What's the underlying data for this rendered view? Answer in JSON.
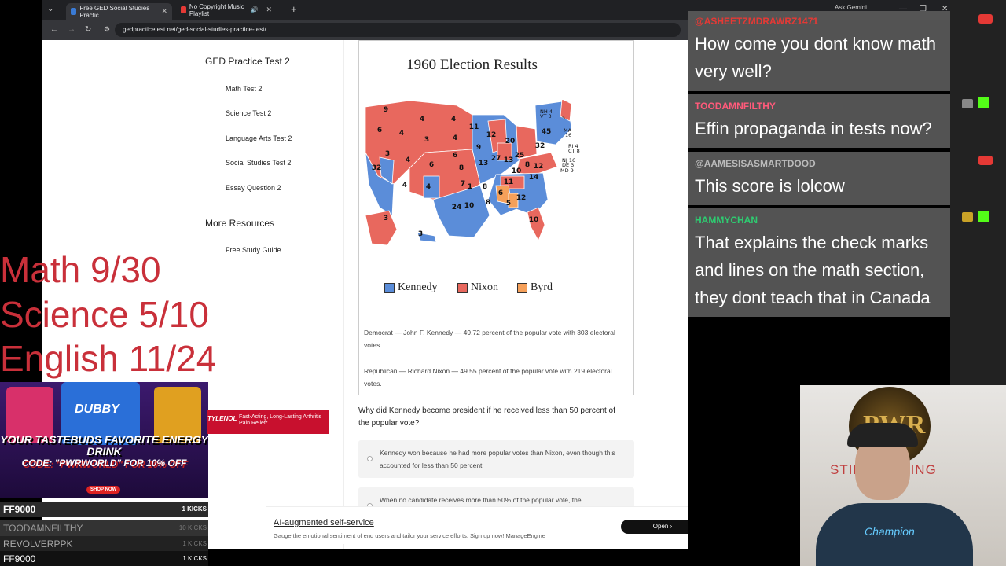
{
  "browser": {
    "tabs": [
      {
        "label": "Free GED Social Studies Practic",
        "active": true
      },
      {
        "label": "No Copyright Music Playlist",
        "active": false
      }
    ],
    "url": "gedpracticetest.net/ged-social-studies-practice-test/",
    "ask_gemini": "Ask Gemini"
  },
  "sidebar": {
    "title": "GED Practice Test 2",
    "links": [
      "Math Test 2",
      "Science Test 2",
      "Language Arts Test 2",
      "Social Studies Test 2",
      "Essay Question 2"
    ],
    "more_title": "More Resources",
    "more_links": [
      "Free Study Guide"
    ]
  },
  "figure": {
    "title": "1960 Election Results",
    "legend": [
      {
        "label": "Kennedy",
        "color": "#5b8dd9"
      },
      {
        "label": "Nixon",
        "color": "#e8685e"
      },
      {
        "label": "Byrd",
        "color": "#f5a05a"
      }
    ],
    "democrat_text": "Democrat — John F. Kennedy — 49.72 percent of the popular vote with 303 electoral votes.",
    "republican_text": "Republican — Richard Nixon — 49.55 percent of the popular vote with 219 electoral votes.",
    "state_labels": [
      {
        "t": "9",
        "c": "r"
      },
      {
        "t": "4",
        "c": "r"
      },
      {
        "t": "4",
        "c": "r"
      },
      {
        "t": "11",
        "c": "b"
      },
      {
        "t": "12",
        "c": "r"
      },
      {
        "t": "6",
        "c": "r"
      },
      {
        "t": "4",
        "c": "r"
      },
      {
        "t": "3",
        "c": "r"
      },
      {
        "t": "4",
        "c": "r"
      },
      {
        "t": "9",
        "c": "r"
      },
      {
        "t": "20",
        "c": "b"
      },
      {
        "t": "32",
        "c": "b"
      },
      {
        "t": "45",
        "c": "b"
      },
      {
        "t": "3",
        "c": "b"
      },
      {
        "t": "4",
        "c": "r"
      },
      {
        "t": "6",
        "c": "r"
      },
      {
        "t": "6",
        "c": "r"
      },
      {
        "t": "13",
        "c": "b"
      },
      {
        "t": "27",
        "c": "b"
      },
      {
        "t": "13",
        "c": "b"
      },
      {
        "t": "25",
        "c": "r"
      },
      {
        "t": "8",
        "c": "b"
      },
      {
        "t": "12",
        "c": "r"
      },
      {
        "t": "32",
        "c": "b"
      },
      {
        "t": "8",
        "c": "r"
      },
      {
        "t": "10",
        "c": "r"
      },
      {
        "t": "14",
        "c": "b"
      },
      {
        "t": "4",
        "c": "r"
      },
      {
        "t": "4",
        "c": "b"
      },
      {
        "t": "7",
        "c": "r"
      },
      {
        "t": "1",
        "c": "r"
      },
      {
        "t": "8",
        "c": "b"
      },
      {
        "t": "11",
        "c": "r"
      },
      {
        "t": "6",
        "c": "o"
      },
      {
        "t": "8",
        "c": "b"
      },
      {
        "t": "12",
        "c": "b"
      },
      {
        "t": "24",
        "c": "b"
      },
      {
        "t": "10",
        "c": "b"
      },
      {
        "t": "5",
        "c": "o"
      },
      {
        "t": "10",
        "c": "r"
      },
      {
        "t": "3",
        "c": "r"
      },
      {
        "t": "3",
        "c": "b"
      }
    ],
    "ne_labels": [
      "NH 4",
      "VT 3",
      "5",
      "MA",
      "16",
      "RI 4",
      "CT 8",
      "NJ 16",
      "DE 3",
      "MD 9"
    ]
  },
  "question": {
    "text": "Why did Kennedy become president if he received less than 50 percent of the popular vote?",
    "options": [
      "Kennedy won because he had more popular votes than Nixon, even though this accounted for less than 50 percent.",
      "When no candidate receives more than 50% of the popular vote, the"
    ]
  },
  "ad": {
    "headline": "AI-augmented self-service",
    "subtext": "Gauge the emotional sentiment of end users and tailor your service efforts. Sign up now! ManageEngine",
    "button": "Open"
  },
  "scores": [
    "Math 9/30",
    "Science 5/10",
    "English 11/24"
  ],
  "promo": {
    "brand": "DUBBY",
    "headline": "YOUR TASTEBUDS FAVORITE ENERGY DRINK",
    "code": "CODE: \"PWRWORLD\" FOR 10% OFF",
    "shop": "SHOP NOW"
  },
  "tylenol": {
    "logo": "TYLENOL",
    "text": "Fast-Acting, Long-Lasting Arthritis Pain Relief*"
  },
  "kicks": [
    {
      "name": "FF9000",
      "kicks": "1 KICKS"
    },
    {
      "name": "TOODAMNFILTHY",
      "kicks": "10 KICKS"
    },
    {
      "name": "REVOLVERPPK",
      "kicks": "1 KICKS"
    },
    {
      "name": "FF9000",
      "kicks": "1 KICKS"
    }
  ],
  "chat": [
    {
      "user": "@ASHEETZMDRAWRZ1471",
      "color": "#e53935",
      "message": "How come you dont know math very well?"
    },
    {
      "user": "TOODAMNFILTHY",
      "color": "#ff5a7a",
      "message": "Effin propaganda in tests now?"
    },
    {
      "user": "@AAMESISASMARTDOOD",
      "color": "#bbbbbb",
      "message": "This score is lolcow"
    },
    {
      "user": "HAMMYCHAN",
      "color": "#2ecc71",
      "message": "That explains the check marks and lines on the math section, they dont teach that in Canada"
    }
  ],
  "webcam": {
    "backdrop_text": "STILL TESTING",
    "brand": "PWR",
    "shirt_logo": "Champion"
  },
  "colors": {
    "democrat": "#5b8dd9",
    "republican": "#e8685e",
    "byrd": "#f5a05a",
    "score_red": "#c9303a"
  }
}
